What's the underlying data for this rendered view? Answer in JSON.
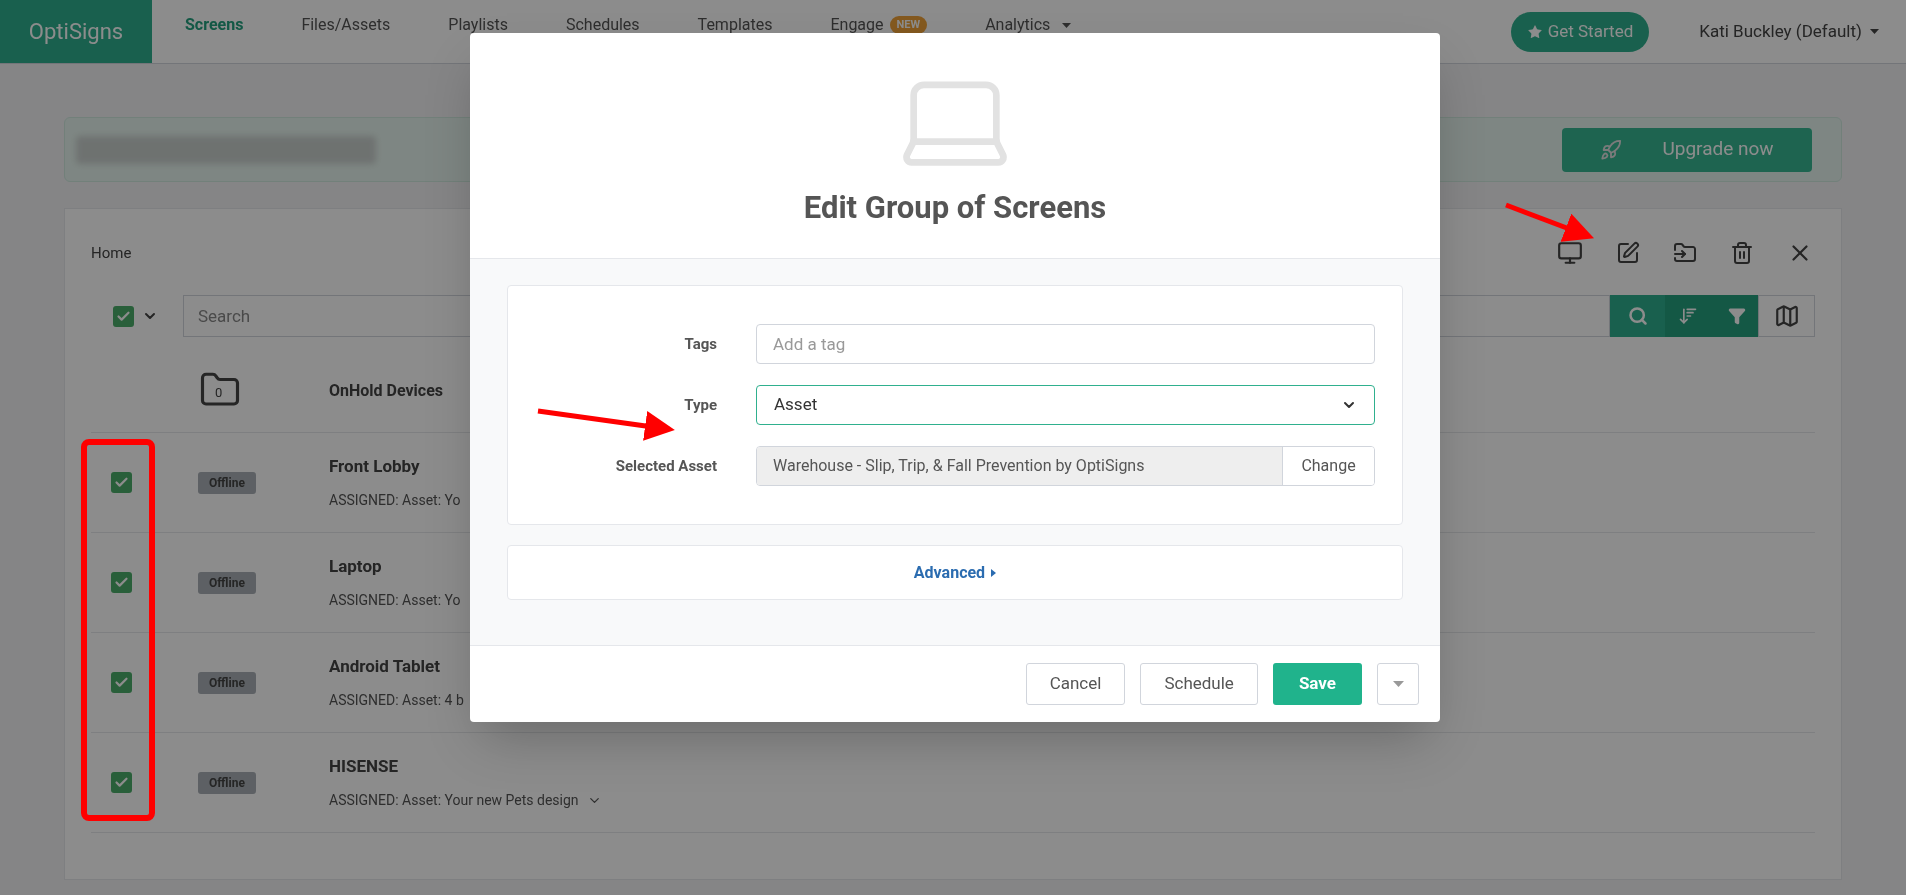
{
  "nav": {
    "logo": "OptiSigns",
    "items": [
      {
        "label": "Screens",
        "selected": true,
        "dropdown": false
      },
      {
        "label": "Files/Assets",
        "selected": false,
        "dropdown": false
      },
      {
        "label": "Playlists",
        "selected": false,
        "dropdown": false
      },
      {
        "label": "Schedules",
        "selected": false,
        "dropdown": false
      },
      {
        "label": "Templates",
        "selected": false,
        "dropdown": false
      },
      {
        "label": "Engage",
        "selected": false,
        "dropdown": false,
        "badge": "NEW"
      },
      {
        "label": "Analytics",
        "selected": false,
        "dropdown": true
      }
    ],
    "get_started": "Get Started",
    "user": "Kati Buckley (Default)"
  },
  "banner": {
    "upgrade_button": "Upgrade now"
  },
  "panel": {
    "breadcrumb": "Home",
    "select_all": {
      "checked": true
    },
    "search": {
      "placeholder": "Search"
    },
    "folder": {
      "count": "0",
      "name": "OnHold Devices"
    },
    "screens": [
      {
        "name": "Front Lobby",
        "status": "Offline",
        "assigned": "ASSIGNED: Asset: Yo",
        "checked": true,
        "expandable": false
      },
      {
        "name": "Laptop",
        "status": "Offline",
        "assigned": "ASSIGNED: Asset: Yo",
        "checked": true,
        "expandable": false
      },
      {
        "name": "Android Tablet",
        "status": "Offline",
        "assigned": "ASSIGNED: Asset: 4 b",
        "checked": true,
        "expandable": false
      },
      {
        "name": "HISENSE",
        "status": "Offline",
        "assigned": "ASSIGNED: Asset: Your new Pets design",
        "checked": true,
        "expandable": true
      }
    ]
  },
  "modal": {
    "title": "Edit Group of Screens",
    "fields": [
      {
        "kind": "input",
        "label": "Tags",
        "placeholder": "Add a tag"
      },
      {
        "kind": "select",
        "label": "Type",
        "value": "Asset"
      },
      {
        "kind": "asset",
        "label": "Selected Asset",
        "value": "Warehouse - Slip, Trip, & Fall Prevention by OptiSigns",
        "button": "Change"
      }
    ],
    "advanced": "Advanced",
    "buttons": [
      {
        "label": "Cancel",
        "kind": "default"
      },
      {
        "label": "Schedule",
        "kind": "default"
      },
      {
        "label": "Save",
        "kind": "primary"
      },
      {
        "kind": "caret"
      }
    ]
  }
}
